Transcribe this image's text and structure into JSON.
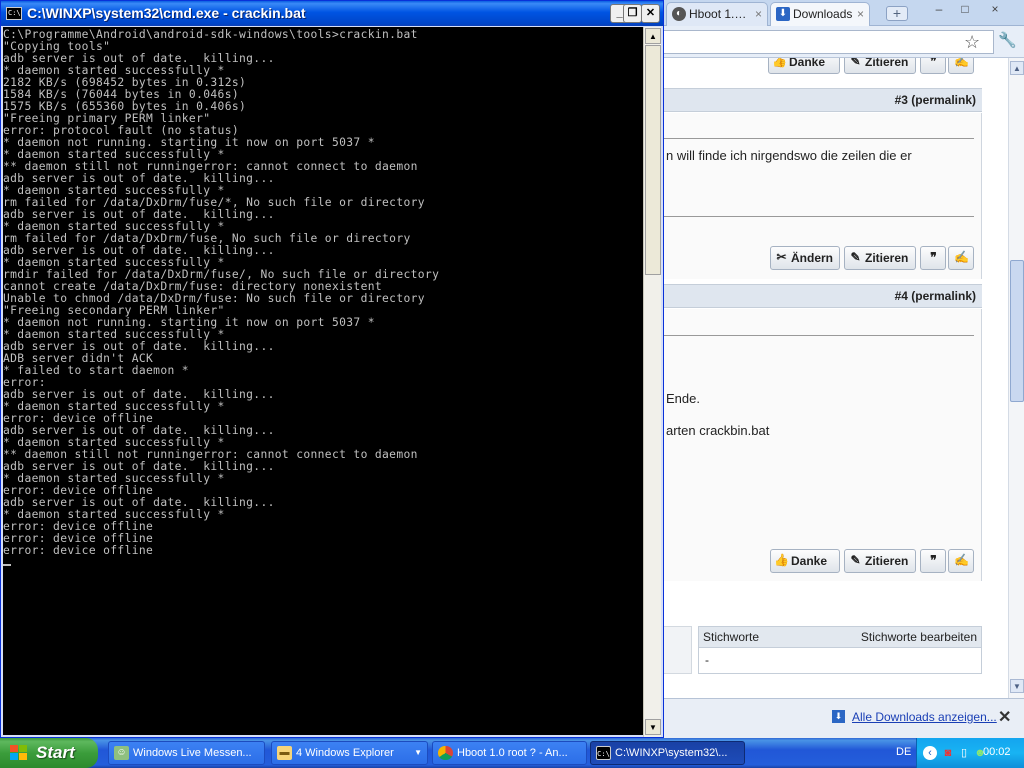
{
  "cmd": {
    "title": "C:\\WINXP\\system32\\cmd.exe - crackin.bat",
    "icon_label": "C:\\",
    "lines": [
      "C:\\Programme\\Android\\android-sdk-windows\\tools>crackin.bat",
      "\"Copying tools\"",
      "adb server is out of date.  killing...",
      "* daemon started successfully *",
      "2182 KB/s (698452 bytes in 0.312s)",
      "1584 KB/s (76044 bytes in 0.046s)",
      "1575 KB/s (655360 bytes in 0.406s)",
      "\"Freeing primary PERM linker\"",
      "error: protocol fault (no status)",
      "* daemon not running. starting it now on port 5037 *",
      "* daemon started successfully *",
      "** daemon still not runningerror: cannot connect to daemon",
      "adb server is out of date.  killing...",
      "* daemon started successfully *",
      "rm failed for /data/DxDrm/fuse/*, No such file or directory",
      "adb server is out of date.  killing...",
      "* daemon started successfully *",
      "rm failed for /data/DxDrm/fuse, No such file or directory",
      "adb server is out of date.  killing...",
      "* daemon started successfully *",
      "rmdir failed for /data/DxDrm/fuse/, No such file or directory",
      "cannot create /data/DxDrm/fuse: directory nonexistent",
      "Unable to chmod /data/DxDrm/fuse: No such file or directory",
      "\"Freeing secondary PERM linker\"",
      "* daemon not running. starting it now on port 5037 *",
      "* daemon started successfully *",
      "adb server is out of date.  killing...",
      "ADB server didn't ACK",
      "* failed to start daemon *",
      "error:",
      "adb server is out of date.  killing...",
      "* daemon started successfully *",
      "error: device offline",
      "adb server is out of date.  killing...",
      "* daemon started successfully *",
      "** daemon still not runningerror: cannot connect to daemon",
      "adb server is out of date.  killing...",
      "* daemon started successfully *",
      "error: device offline",
      "adb server is out of date.  killing...",
      "* daemon started successfully *",
      "error: device offline",
      "error: device offline",
      "error: device offline"
    ]
  },
  "browser": {
    "tabs": [
      {
        "label": "Hboot 1.…",
        "close": "×"
      },
      {
        "label": "Downloads",
        "close": "×"
      }
    ],
    "new_tab": "+",
    "window_controls": {
      "minimize": "–",
      "maximize": "□",
      "close": "×"
    },
    "posts": [
      {
        "header": "#3 (permalink)",
        "text": "n will finde ich nirgendswo die zeilen die er",
        "buttons": {
          "edit": "Ändern",
          "quote": "Zitieren"
        }
      },
      {
        "header": "#4 (permalink)",
        "text_lines": [
          "Ende.",
          "arten crackbin.bat"
        ],
        "buttons": {
          "thanks": "Danke",
          "quote": "Zitieren"
        }
      }
    ],
    "top_buttons": {
      "thanks": "Danke",
      "quote": "Zitieren"
    },
    "tags": {
      "title": "Stichworte",
      "edit": "Stichworte bearbeiten",
      "value": "-"
    },
    "downloads_bar": {
      "link": "Alle Downloads anzeigen...",
      "close": "✕"
    }
  },
  "taskbar": {
    "start": "Start",
    "items": [
      {
        "label": "Windows Live Messen..."
      },
      {
        "label": "4 Windows Explorer"
      },
      {
        "label": "Hboot 1.0 root ? - An..."
      },
      {
        "label": "C:\\WINXP\\system32\\..."
      }
    ],
    "lang": "DE",
    "clock": "00:02"
  },
  "colors": {
    "console_bg": "#000000",
    "console_fg": "#c0c0c0",
    "xp_title_blue": "#0054e3",
    "start_green": "#3b9d3b"
  },
  "icons": [
    "cmd-icon",
    "star-icon",
    "wrench-icon",
    "download-icon",
    "windows-logo-icon",
    "messenger-icon",
    "folder-icon",
    "chrome-icon",
    "edit-icon",
    "quote-icon",
    "thanks-icon"
  ]
}
